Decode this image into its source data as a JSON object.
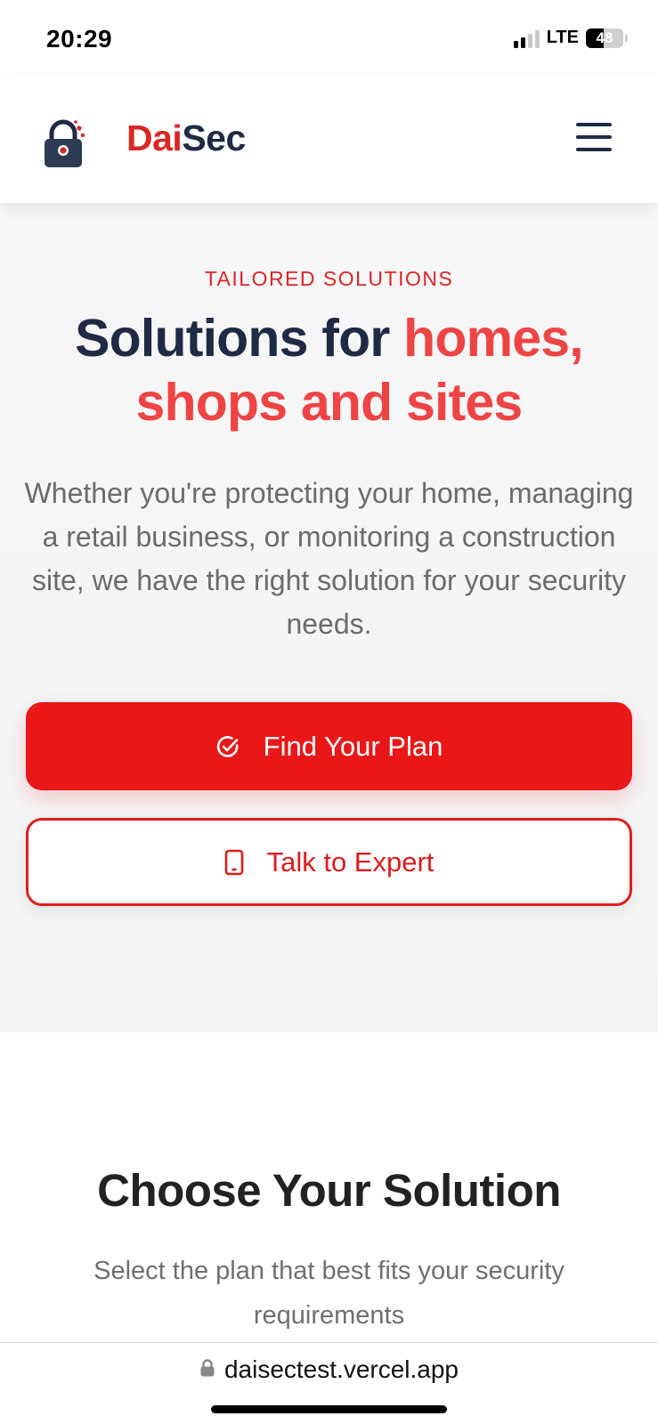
{
  "status_bar": {
    "time": "20:29",
    "network": "LTE",
    "battery": "48",
    "battery_level": 0.48
  },
  "header": {
    "brand_part1": "Dai",
    "brand_part2": "Sec",
    "logo_icon": "padlock-icon",
    "menu_icon": "hamburger-menu-icon"
  },
  "hero": {
    "eyebrow": "TAILORED SOLUTIONS",
    "title_dark": "Solutions for ",
    "title_accent": "homes, shops and sites",
    "description": "Whether you're protecting your home, managing a retail business, or monitoring a construction site, we have the right solution for your security needs.",
    "primary_button": {
      "label": "Find Your Plan",
      "icon": "check-circle-icon"
    },
    "secondary_button": {
      "label": "Talk to Expert",
      "icon": "phone-icon"
    }
  },
  "solutions": {
    "title": "Choose Your Solution",
    "subtitle": "Select the plan that best fits your security requirements"
  },
  "browser": {
    "url": "daisectest.vercel.app",
    "lock_icon": "lock-icon"
  },
  "colors": {
    "brand_red": "#dc2626",
    "brand_navy": "#1f2a44",
    "accent_red": "#ef4444",
    "button_red": "#e91717"
  }
}
